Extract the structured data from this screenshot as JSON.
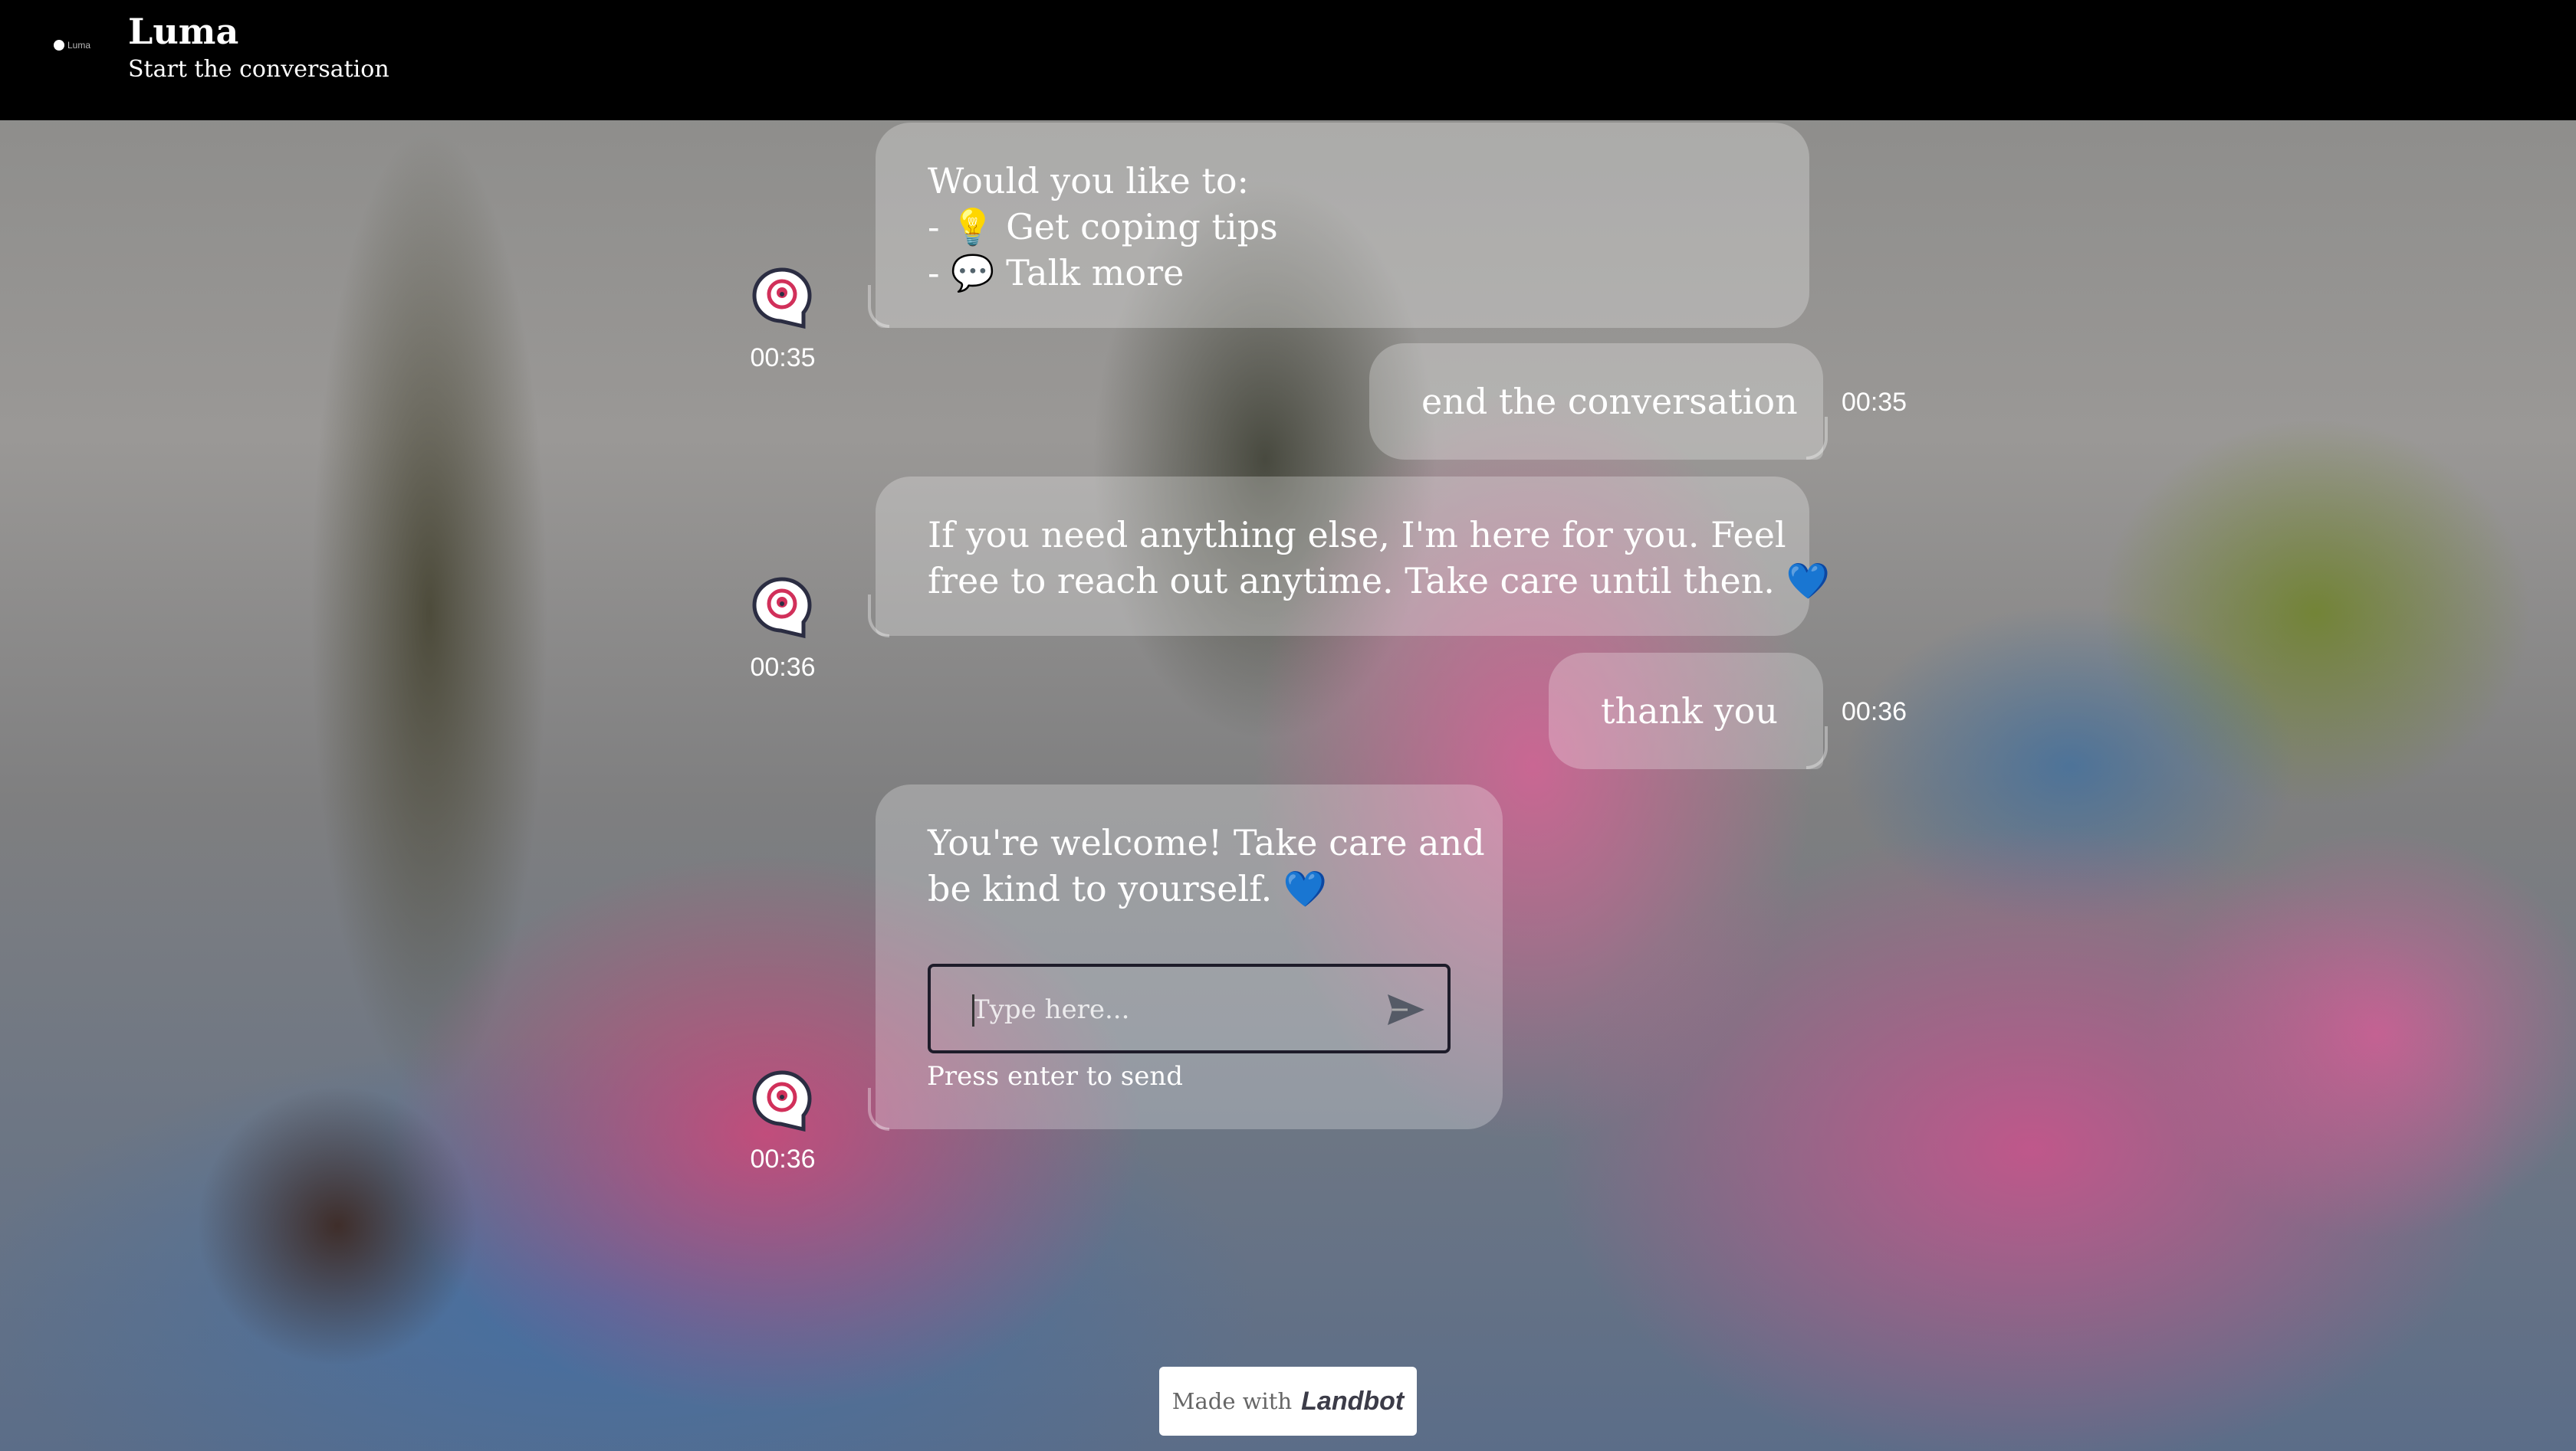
{
  "header": {
    "logo_text": "Luma",
    "title": "Luma",
    "subtitle": "Start the conversation"
  },
  "messages": [
    {
      "sender": "bot",
      "lines": [
        "Would you like to:",
        "- 💡 Get coping tips",
        "- 💬 Talk more"
      ],
      "time": "00:35"
    },
    {
      "sender": "user",
      "lines": [
        "end the conversation"
      ],
      "time": "00:35"
    },
    {
      "sender": "bot",
      "lines": [
        "If you need anything else, I'm here for you. Feel",
        "free to reach out anytime. Take care until then. 💙"
      ],
      "time": "00:36"
    },
    {
      "sender": "user",
      "lines": [
        "thank you"
      ],
      "time": "00:36"
    },
    {
      "sender": "bot",
      "lines": [
        "You're welcome! Take care and",
        "be kind to yourself. 💙"
      ],
      "time": "00:36"
    }
  ],
  "composer": {
    "placeholder": "Type here...",
    "hint": "Press enter to send"
  },
  "footer": {
    "made_with": "Made with",
    "brand": "Landbot"
  },
  "colors": {
    "header_bg": "#000000",
    "bubble_bg": "rgba(255,255,255,0.26)",
    "text": "#ffffff",
    "avatar_accent": "#d1305a",
    "avatar_outline": "#2b2d42"
  },
  "icons": {
    "avatar": "speech-bubble-eye-icon",
    "send": "send-arrow-icon"
  }
}
